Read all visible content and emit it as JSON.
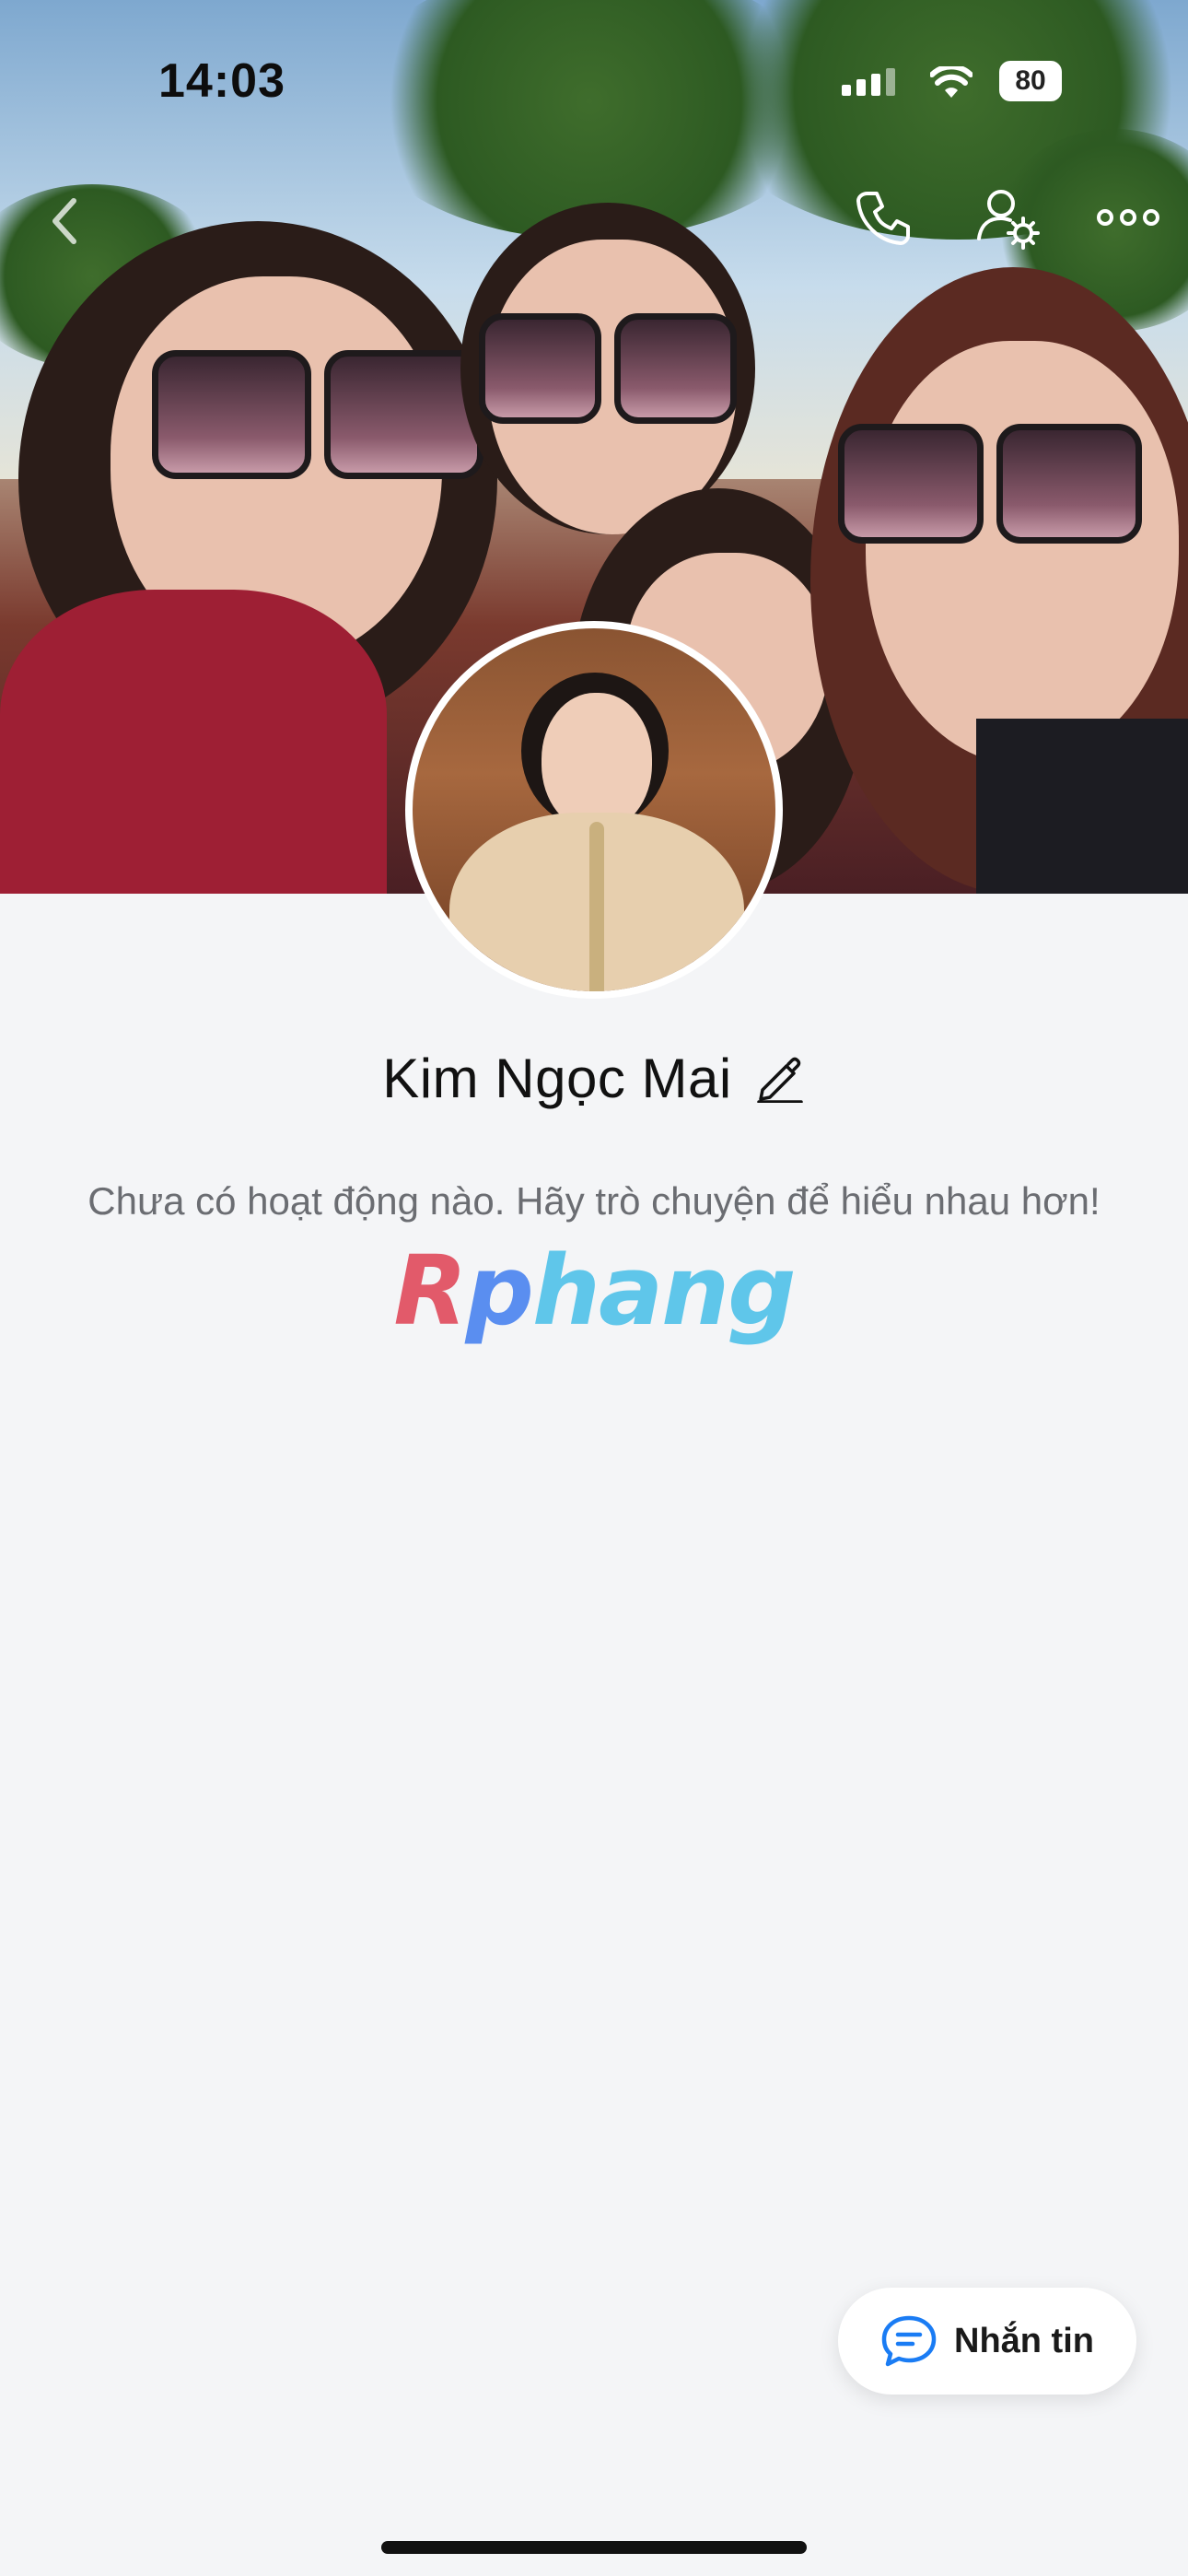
{
  "status_bar": {
    "time": "14:03",
    "battery": "80",
    "signal_icon": "cellular-signal-icon",
    "wifi_icon": "wifi-icon",
    "battery_icon": "battery-icon"
  },
  "header": {
    "back_icon": "chevron-left-icon",
    "call_icon": "phone-icon",
    "settings_icon": "user-settings-icon",
    "more_icon": "more-horizontal-icon"
  },
  "profile": {
    "name": "Kim Ngọc Mai",
    "edit_icon": "pencil-icon"
  },
  "feed": {
    "empty_message": "Chưa có hoạt động nào. Hãy trò chuyện để hiểu nhau hơn!"
  },
  "watermark": {
    "part1": "R",
    "part2": "p",
    "part3": "hang"
  },
  "actions": {
    "message_label": "Nhắn tin",
    "message_icon": "chat-bubble-icon"
  },
  "colors": {
    "background": "#f4f5f7",
    "accent_blue": "#1a7cf4",
    "text_primary": "#111111",
    "text_secondary": "#6b6d72"
  }
}
